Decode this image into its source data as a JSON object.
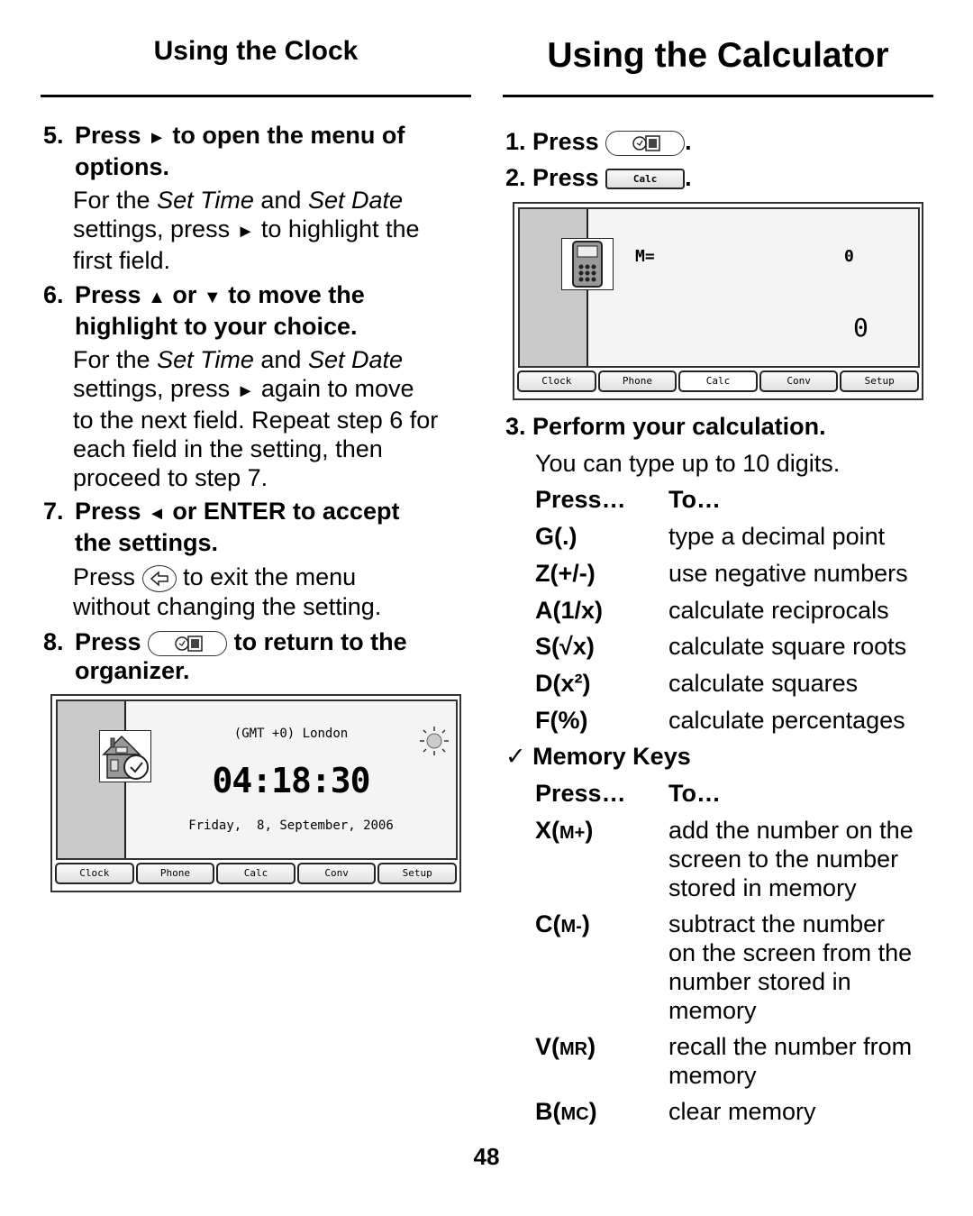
{
  "clock_section": {
    "title": "Using the Clock",
    "steps": [
      {
        "num": "5.",
        "line1_pre": "Press",
        "line1_arrow": "►",
        "line1_post": "to open the menu of",
        "line2": "options.",
        "body": {
          "l1_pre": "For the",
          "l1_i1": "Set Time",
          "l1_mid": "and",
          "l1_i2": "Set Date",
          "l2_pre": "settings, press",
          "l2_arrow": "►",
          "l2_post": "to highlight the",
          "l3": "first field."
        }
      },
      {
        "num": "6.",
        "line1_pre": "Press",
        "up": "▲",
        "or": "or",
        "down": "▼",
        "line1_post": "to move the",
        "line2": "highlight to your choice.",
        "body": {
          "l1_pre": "For the",
          "l1_i1": "Set Time",
          "l1_mid": "and",
          "l1_i2": "Set Date",
          "l2_pre": "settings, press",
          "l2_arrow": "►",
          "l2_post": "again to move",
          "l3": "to the next field. Repeat step 6 for",
          "l4": "each field in the setting, then",
          "l5": "proceed to step 7."
        }
      },
      {
        "num": "7.",
        "line1_pre": "Press",
        "left": "◄",
        "line1_post": "or ENTER to accept",
        "line2": "the settings.",
        "body": {
          "l1_pre": "Press",
          "l1_post": "to exit the menu",
          "l2": "without changing the setting."
        }
      },
      {
        "num": "8.",
        "line1_pre": "Press",
        "line1_post": "to return to the",
        "line2": "organizer."
      }
    ],
    "screen": {
      "timezone": "(GMT +0) London",
      "time": "04:18:30",
      "date": "Friday,  8, September, 2006",
      "tabs": [
        "Clock",
        "Phone",
        "Calc",
        "Conv",
        "Setup"
      ]
    }
  },
  "calc_section": {
    "title": "Using the Calculator",
    "step1": {
      "num": "1.",
      "label": "Press",
      "end": "."
    },
    "step2": {
      "num": "2.",
      "label": "Press",
      "key": "Calc",
      "end": "."
    },
    "screen": {
      "memory_label": "M=",
      "memory_value": "0",
      "display_value": "0",
      "tabs": [
        "Clock",
        "Phone",
        "Calc",
        "Conv",
        "Setup"
      ],
      "active_tab": "Calc"
    },
    "step3": {
      "num": "3.",
      "label": "Perform your calculation.",
      "body": "You can type up to 10 digits."
    },
    "table1": {
      "header": {
        "press": "Press…",
        "to": "To…"
      },
      "rows": [
        {
          "key": "G(.)",
          "action": "type a decimal point"
        },
        {
          "key": "Z(+/-)",
          "action": "use negative numbers"
        },
        {
          "key": "A(1/x)",
          "action": "calculate reciprocals"
        },
        {
          "key": "S(√x)",
          "action": "calculate square roots"
        },
        {
          "key": "D(x²)",
          "action": "calculate squares"
        },
        {
          "key": "F(%)",
          "action": "calculate percentages"
        }
      ]
    },
    "memory": {
      "check": "✓",
      "title": "Memory Keys",
      "header": {
        "press": "Press…",
        "to": "To…"
      },
      "rows": [
        {
          "key_letter": "X(",
          "key_sc": "M+",
          "key_end": ")",
          "lines": [
            "add the number on the",
            "screen to the number",
            "stored in memory"
          ]
        },
        {
          "key_letter": "C(",
          "key_sc": "M-",
          "key_end": ")",
          "lines": [
            "subtract the number",
            "on the screen from the",
            "number stored in",
            "memory"
          ]
        },
        {
          "key_letter": "V(",
          "key_sc": "MR",
          "key_end": ")",
          "lines": [
            "recall the number from",
            "memory"
          ]
        },
        {
          "key_letter": "B(",
          "key_sc": "MC",
          "key_end": ")",
          "lines": [
            "clear memory"
          ]
        }
      ]
    }
  },
  "page_number": "48"
}
